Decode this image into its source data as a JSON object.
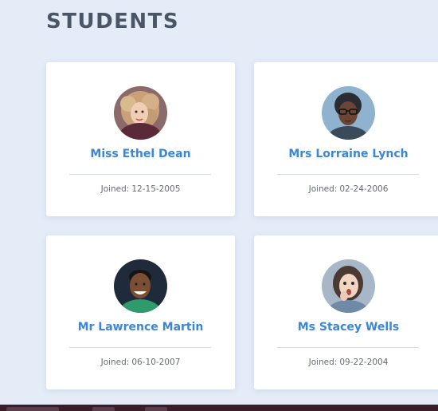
{
  "page": {
    "title": "STUDENTS"
  },
  "students": [
    {
      "name": "Miss Ethel Dean",
      "joined_label": "Joined:",
      "joined_date": "12-15-2005",
      "avatar_icon": "avatar-woman-curly-hair"
    },
    {
      "name": "Mrs Lorraine Lynch",
      "joined_label": "Joined:",
      "joined_date": "02-24-2006",
      "avatar_icon": "avatar-woman-glasses"
    },
    {
      "name": "Mr Lawrence Martin",
      "joined_label": "Joined:",
      "joined_date": "06-10-2007",
      "avatar_icon": "avatar-man-smiling"
    },
    {
      "name": "Ms Stacey Wells",
      "joined_label": "Joined:",
      "joined_date": "09-22-2004",
      "avatar_icon": "avatar-woman-surprised"
    }
  ],
  "colors": {
    "background": "#e4ecf8",
    "title": "#4a5566",
    "name": "#3a86d9",
    "joined_text": "#666c75",
    "card": "#ffffff"
  }
}
